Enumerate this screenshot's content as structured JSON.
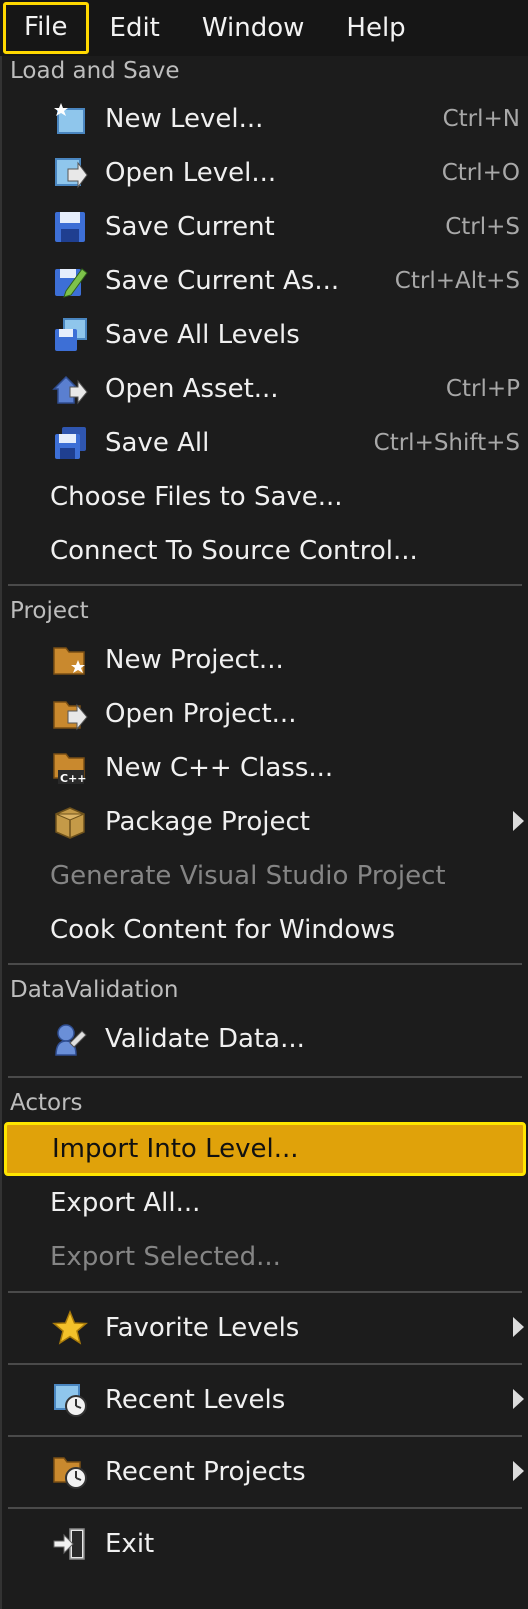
{
  "menubar": {
    "file": "File",
    "edit": "Edit",
    "window": "Window",
    "help": "Help"
  },
  "sections": {
    "load_save": "Load and Save",
    "project": "Project",
    "data_validation": "DataValidation",
    "actors": "Actors"
  },
  "items": {
    "new_level": {
      "label": "New Level...",
      "shortcut": "Ctrl+N"
    },
    "open_level": {
      "label": "Open Level...",
      "shortcut": "Ctrl+O"
    },
    "save_current": {
      "label": "Save Current",
      "shortcut": "Ctrl+S"
    },
    "save_current_as": {
      "label": "Save Current As...",
      "shortcut": "Ctrl+Alt+S"
    },
    "save_all_levels": {
      "label": "Save All Levels"
    },
    "open_asset": {
      "label": "Open Asset...",
      "shortcut": "Ctrl+P"
    },
    "save_all": {
      "label": "Save All",
      "shortcut": "Ctrl+Shift+S"
    },
    "choose_files": {
      "label": "Choose Files to Save..."
    },
    "connect_source": {
      "label": "Connect To Source Control..."
    },
    "new_project": {
      "label": "New Project..."
    },
    "open_project": {
      "label": "Open Project..."
    },
    "new_cpp_class": {
      "label": "New C++ Class..."
    },
    "package_project": {
      "label": "Package Project"
    },
    "generate_vs": {
      "label": "Generate Visual Studio Project"
    },
    "cook_content": {
      "label": "Cook Content for Windows"
    },
    "validate_data": {
      "label": "Validate Data..."
    },
    "import_into_level": {
      "label": "Import Into Level..."
    },
    "export_all": {
      "label": "Export All..."
    },
    "export_selected": {
      "label": "Export Selected..."
    },
    "favorite_levels": {
      "label": "Favorite Levels"
    },
    "recent_levels": {
      "label": "Recent Levels"
    },
    "recent_projects": {
      "label": "Recent Projects"
    },
    "exit": {
      "label": "Exit"
    }
  },
  "colors": {
    "highlight": "#e0a20a",
    "focus_border": "#ffe600",
    "menu_bg": "#1c1c1c"
  }
}
